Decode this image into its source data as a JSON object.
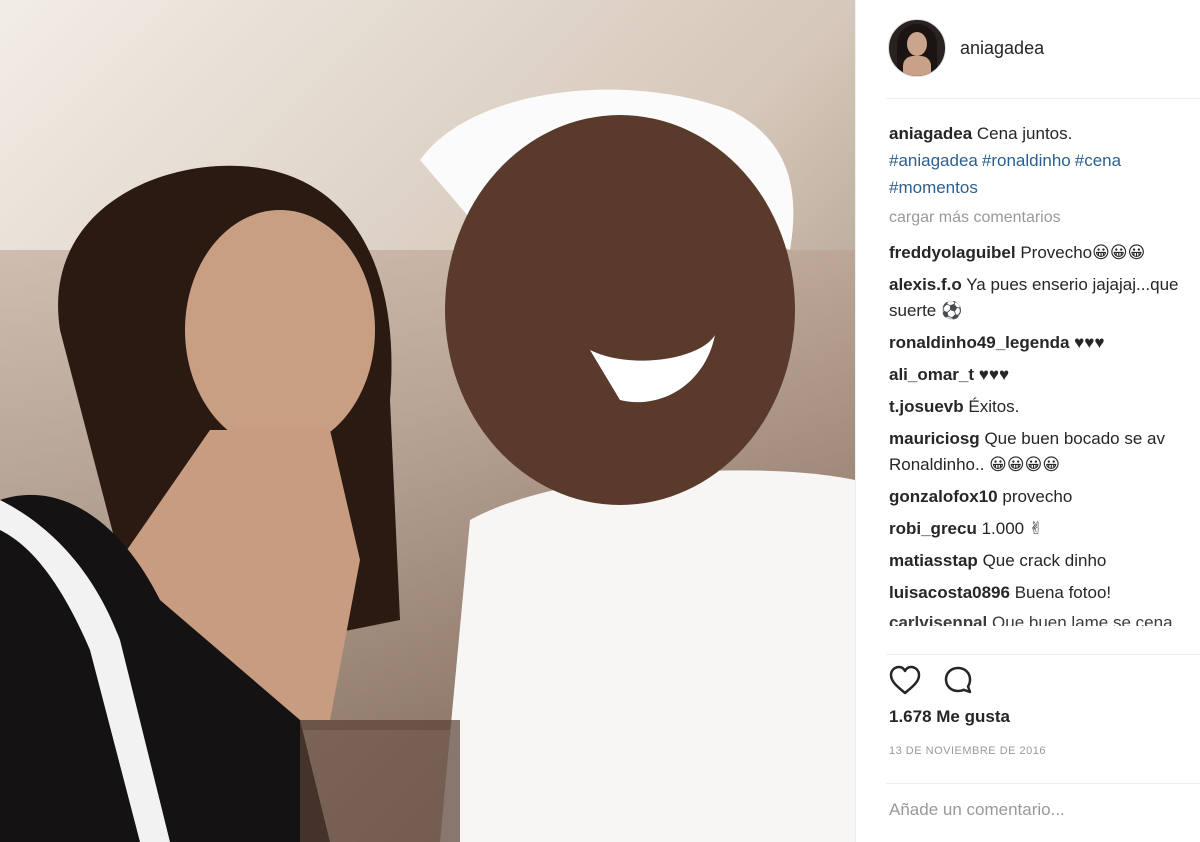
{
  "post": {
    "username": "aniagadea",
    "caption_text": "Cena juntos.",
    "hashtags": [
      "#aniagadea",
      "#ronaldinho",
      "#cena",
      "#momentos"
    ],
    "load_more_label": "cargar más comentarios",
    "comments": [
      {
        "user": "freddyolaguibel",
        "text": "Provecho😀😀😀"
      },
      {
        "user": "alexis.f.o",
        "text": "Ya pues enserio jajajaj...que suerte ⚽"
      },
      {
        "user": "ronaldinho49_legenda",
        "text": "♥♥♥"
      },
      {
        "user": "ali_omar_t",
        "text": "♥♥♥"
      },
      {
        "user": "t.josuevb",
        "text": "Éxitos."
      },
      {
        "user": "mauriciosg",
        "text": "Que buen bocado se av Ronaldinho.. 😀😀😀😀"
      },
      {
        "user": "gonzalofox10",
        "text": "provecho"
      },
      {
        "user": "robi_grecu",
        "text": "1.000 ✌"
      },
      {
        "user": "matiasstap",
        "text": "Que crack dinho"
      },
      {
        "user": "luisacosta0896",
        "text": "Buena fotoo!"
      },
      {
        "user": "carlvisenpal",
        "text": "Que buen lame se cena"
      }
    ],
    "likes": "1.678 Me gusta",
    "date": "13 DE NOVIEMBRE DE 2016",
    "add_comment_placeholder": "Añade un comentario..."
  },
  "icons": {
    "like": "heart-icon",
    "comment": "comment-bubble-icon"
  }
}
